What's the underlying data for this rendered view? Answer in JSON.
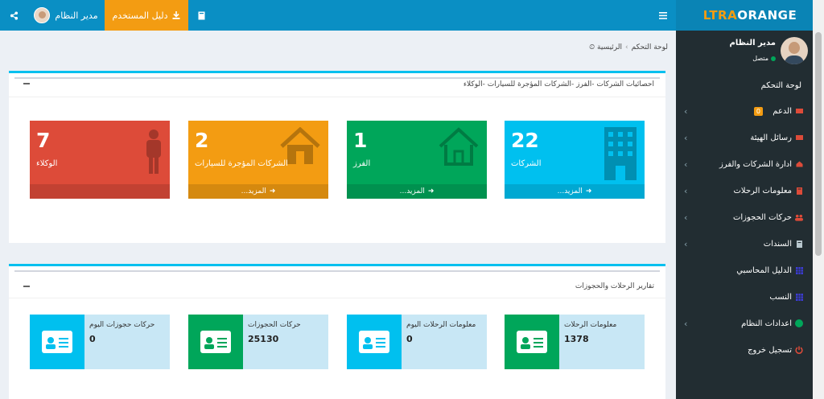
{
  "brand": {
    "part1": "LTRA",
    "part2": "ORANGE"
  },
  "topbar": {
    "user_name": "مدير النظام",
    "guide_label": "دليل المستخدم"
  },
  "sidebar": {
    "user_name": "مدير النظام",
    "status": "متصل",
    "items": [
      {
        "label": "لوحة التحكم"
      },
      {
        "label": "الدعم",
        "badge": "0"
      },
      {
        "label": "رسائل الهيئة"
      },
      {
        "label": "ادارة الشركات والفرز"
      },
      {
        "label": "معلومات الرحلات"
      },
      {
        "label": "حركات الحجوزات"
      },
      {
        "label": "السندات"
      },
      {
        "label": "الدليل المحاسبي"
      },
      {
        "label": "النسب"
      },
      {
        "label": "اعدادات النظام"
      },
      {
        "label": "تسجيل خروج"
      }
    ]
  },
  "breadcrumb": {
    "home": "الرئيسية",
    "current": "لوحة التحكم"
  },
  "stats_panel": {
    "title": "احصائيات الشركات -الفرز -الشركات المؤجرة للسيارات -الوكلاء",
    "tiles": [
      {
        "value": "22",
        "label": "الشركات",
        "more": "...المزيد",
        "color": "#00c0ef"
      },
      {
        "value": "1",
        "label": "الفرز",
        "more": "...المزيد",
        "color": "#00a65a"
      },
      {
        "value": "2",
        "label": "الشركات المؤجرة للسيارات",
        "more": "...المزيد",
        "color": "#f39c12"
      },
      {
        "value": "7",
        "label": "الوكلاء",
        "color": "#dd4b39"
      }
    ]
  },
  "reports_panel": {
    "title": "تقارير الرحلات والحجوزات",
    "boxes": [
      {
        "label": "معلومات الرحلات",
        "value": "1378",
        "icon_color": "#00a65a"
      },
      {
        "label": "معلومات الرحلات اليوم",
        "value": "0",
        "icon_color": "#00c0ef"
      },
      {
        "label": "حركات الحجوزات",
        "value": "25130",
        "icon_color": "#00a65a"
      },
      {
        "label": "حركات حجوزات اليوم",
        "value": "0",
        "icon_color": "#00c0ef"
      }
    ]
  }
}
